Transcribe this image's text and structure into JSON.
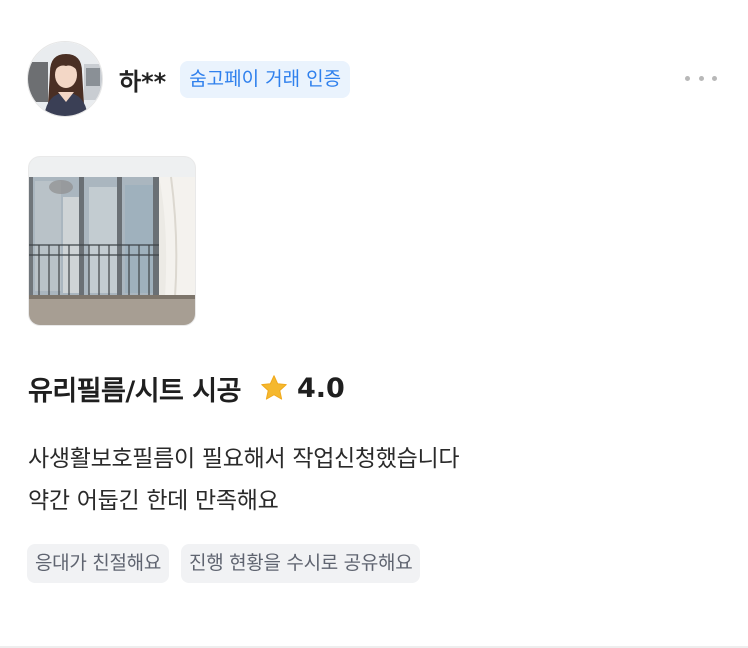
{
  "review": {
    "username": "하**",
    "badge_label": "숨고페이 거래 인증",
    "more_icon": "more-horizontal-icon",
    "photo_alt": "window-balcony-photo",
    "service_title": "유리필름/시트 시공",
    "rating": "4.0",
    "star_icon": "star-icon",
    "star_color": "#f5b82e",
    "body_lines": [
      "사생활보호필름이 필요해서 작업신청했습니다",
      "약간 어둡긴 한데 만족해요"
    ],
    "tags": [
      "응대가 친절해요",
      "진행 현황을 수시로 공유해요"
    ]
  },
  "colors": {
    "badge_bg": "#eaf3fd",
    "badge_text": "#2f80ed",
    "tag_bg": "#f1f2f4",
    "tag_text": "#5f6470"
  }
}
